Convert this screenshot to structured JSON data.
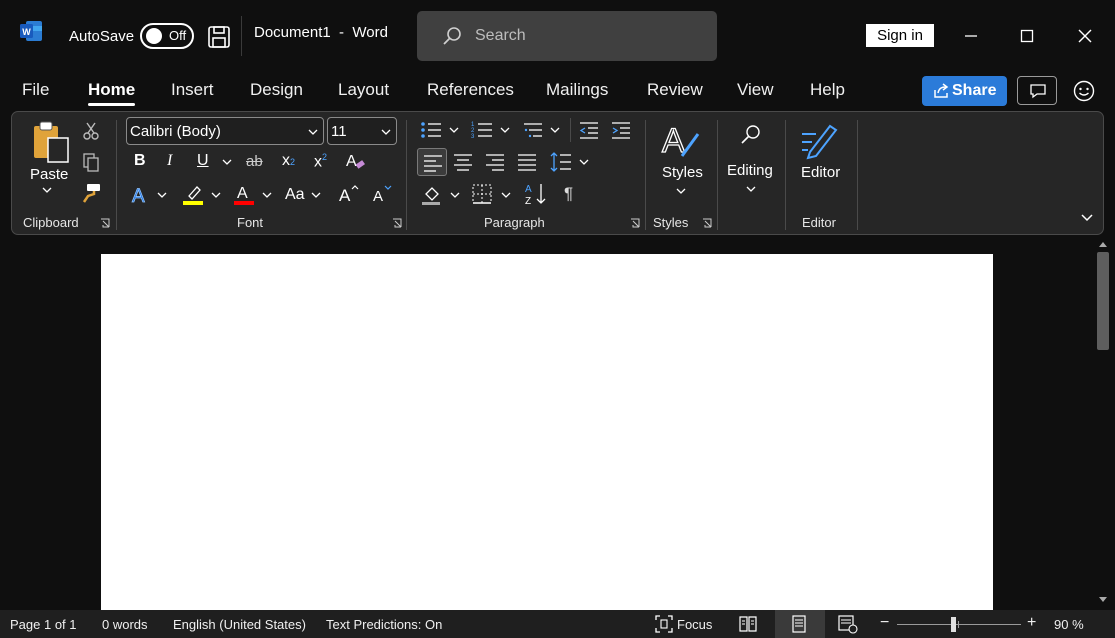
{
  "titlebar": {
    "autosave_label": "AutoSave",
    "autosave_state": "Off",
    "document_title": "Document1  -  Word",
    "search_placeholder": "Search",
    "sign_in": "Sign in"
  },
  "tabs": [
    {
      "label": "File"
    },
    {
      "label": "Home",
      "active": true
    },
    {
      "label": "Insert"
    },
    {
      "label": "Design"
    },
    {
      "label": "Layout"
    },
    {
      "label": "References"
    },
    {
      "label": "Mailings"
    },
    {
      "label": "Review"
    },
    {
      "label": "View"
    },
    {
      "label": "Help"
    }
  ],
  "share_label": "Share",
  "ribbon": {
    "clipboard": {
      "paste_label": "Paste",
      "group_label": "Clipboard"
    },
    "font": {
      "font_name": "Calibri (Body)",
      "font_size": "11",
      "group_label": "Font",
      "bold": "B",
      "italic": "I",
      "underline": "U",
      "strike": "ab",
      "subscript": "x",
      "superscript": "x",
      "change_case": "Aa",
      "highlight_color": "#ffff00",
      "font_color": "#ff0000"
    },
    "paragraph": {
      "group_label": "Paragraph"
    },
    "styles": {
      "label": "Styles",
      "group_label": "Styles"
    },
    "editing": {
      "label": "Editing"
    },
    "editor": {
      "label": "Editor",
      "group_label": "Editor"
    }
  },
  "statusbar": {
    "page": "Page 1 of 1",
    "words": "0 words",
    "language": "English (United States)",
    "predictions": "Text Predictions: On",
    "focus": "Focus",
    "zoom_minus": "−",
    "zoom_plus": "+",
    "zoom": "90 %"
  },
  "colors": {
    "accent": "#2b7bd9",
    "background": "#0f0f0f",
    "ribbon": "#262626"
  }
}
